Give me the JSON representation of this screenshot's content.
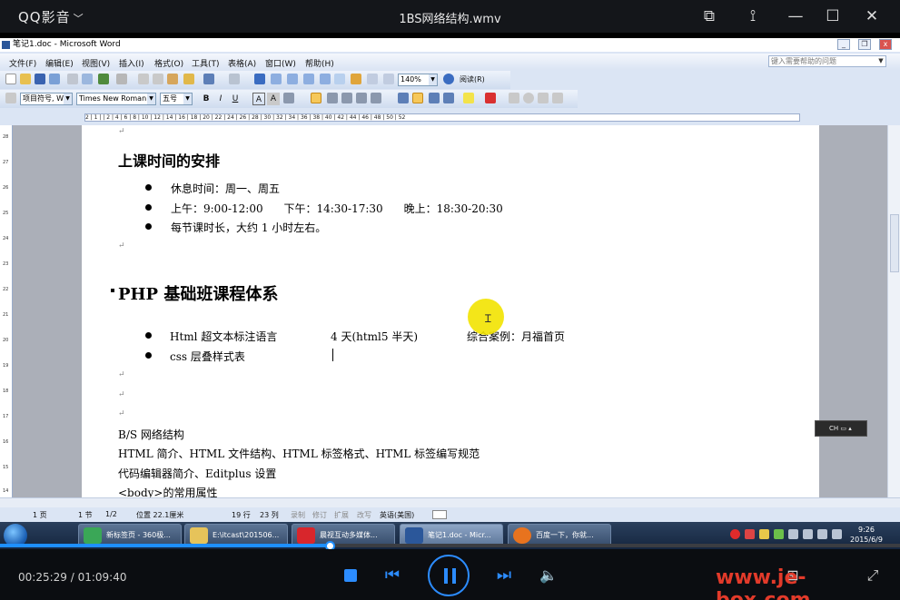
{
  "player": {
    "brand": "QQ影音",
    "title": "1BS网络结构.wmv",
    "time": "00:25:29 / 01:09:40",
    "progress_fraction": 0.366,
    "watermark": "www.je-box.com"
  },
  "word": {
    "window_title": "笔记1.doc - Microsoft Word",
    "menu": [
      "文件(F)",
      "编辑(E)",
      "视图(V)",
      "插入(I)",
      "格式(O)",
      "工具(T)",
      "表格(A)",
      "窗口(W)",
      "帮助(H)"
    ],
    "help_placeholder": "键入需要帮助的问题",
    "zoom": "140%",
    "read_label": "阅读(R)",
    "style_value": "项目符号, W",
    "font_value": "Times New Roman",
    "size_value": "五号",
    "fmt_bold": "B",
    "fmt_italic": "I",
    "fmt_underline": "U",
    "fmt_a1": "A",
    "fmt_a2": "A",
    "ruler_text": "2 | 1 | | 2 | 4 | 6 | 8 | 10 | 12 | 14 | 16 | 18 | 20 | 22 | 24 | 26 | 28 | 30 | 32 | 34 | 36 | 38 | 40 | 42 | 44 | 46 | 48 | 50 | 52",
    "vruler": [
      "28",
      "27",
      "26",
      "25",
      "24",
      "23",
      "22",
      "21",
      "20",
      "19",
      "18",
      "17",
      "16",
      "15",
      "14"
    ],
    "doc": {
      "heading1": "上课时间的安排",
      "schedule": [
        "休息时间：周一、周五",
        "上午：9:00-12:00      下午：14:30-17:30      晚上：18:30-20:30",
        "每节课时长，大约 1 小时左右。"
      ],
      "heading2": "PHP 基础班课程体系",
      "course": {
        "row1_name": "Html 超文本标注语言",
        "row1_days": "4 天(html5 半天)",
        "row1_case": "综合案例：月福首页",
        "row2_name": "css 层叠样式表"
      },
      "lines": [
        "B/S 网络结构",
        "HTML 简介、HTML 文件结构、HTML 标签格式、HTML 标签编写规范",
        "代码编辑器简介、Editplus 设置",
        "<body>的常用属性"
      ]
    },
    "status": {
      "page": "1 页",
      "section": "1 节",
      "pages": "1/2",
      "position": "位置 22.1厘米",
      "line": "19 行",
      "col": "23 列",
      "rec": "录制",
      "trk": "修订",
      "ext": "扩展",
      "ovr": "改写",
      "lang": "英语(美国)"
    }
  },
  "taskbar": {
    "tasks": [
      {
        "label": "新标签页 - 360极...",
        "color": "#3aa757"
      },
      {
        "label": "E:\\itcast\\201506...",
        "color": "#e6c35a"
      },
      {
        "label": "晨视互动多媒体...",
        "color": "#d8262c"
      },
      {
        "label": "笔记1.doc - Micr...",
        "color": "#2b579a"
      },
      {
        "label": "百度一下，你就...",
        "color": "#e8731e"
      }
    ],
    "clock_time": "9:26",
    "clock_date": "2015/6/9",
    "ime": "CH"
  }
}
